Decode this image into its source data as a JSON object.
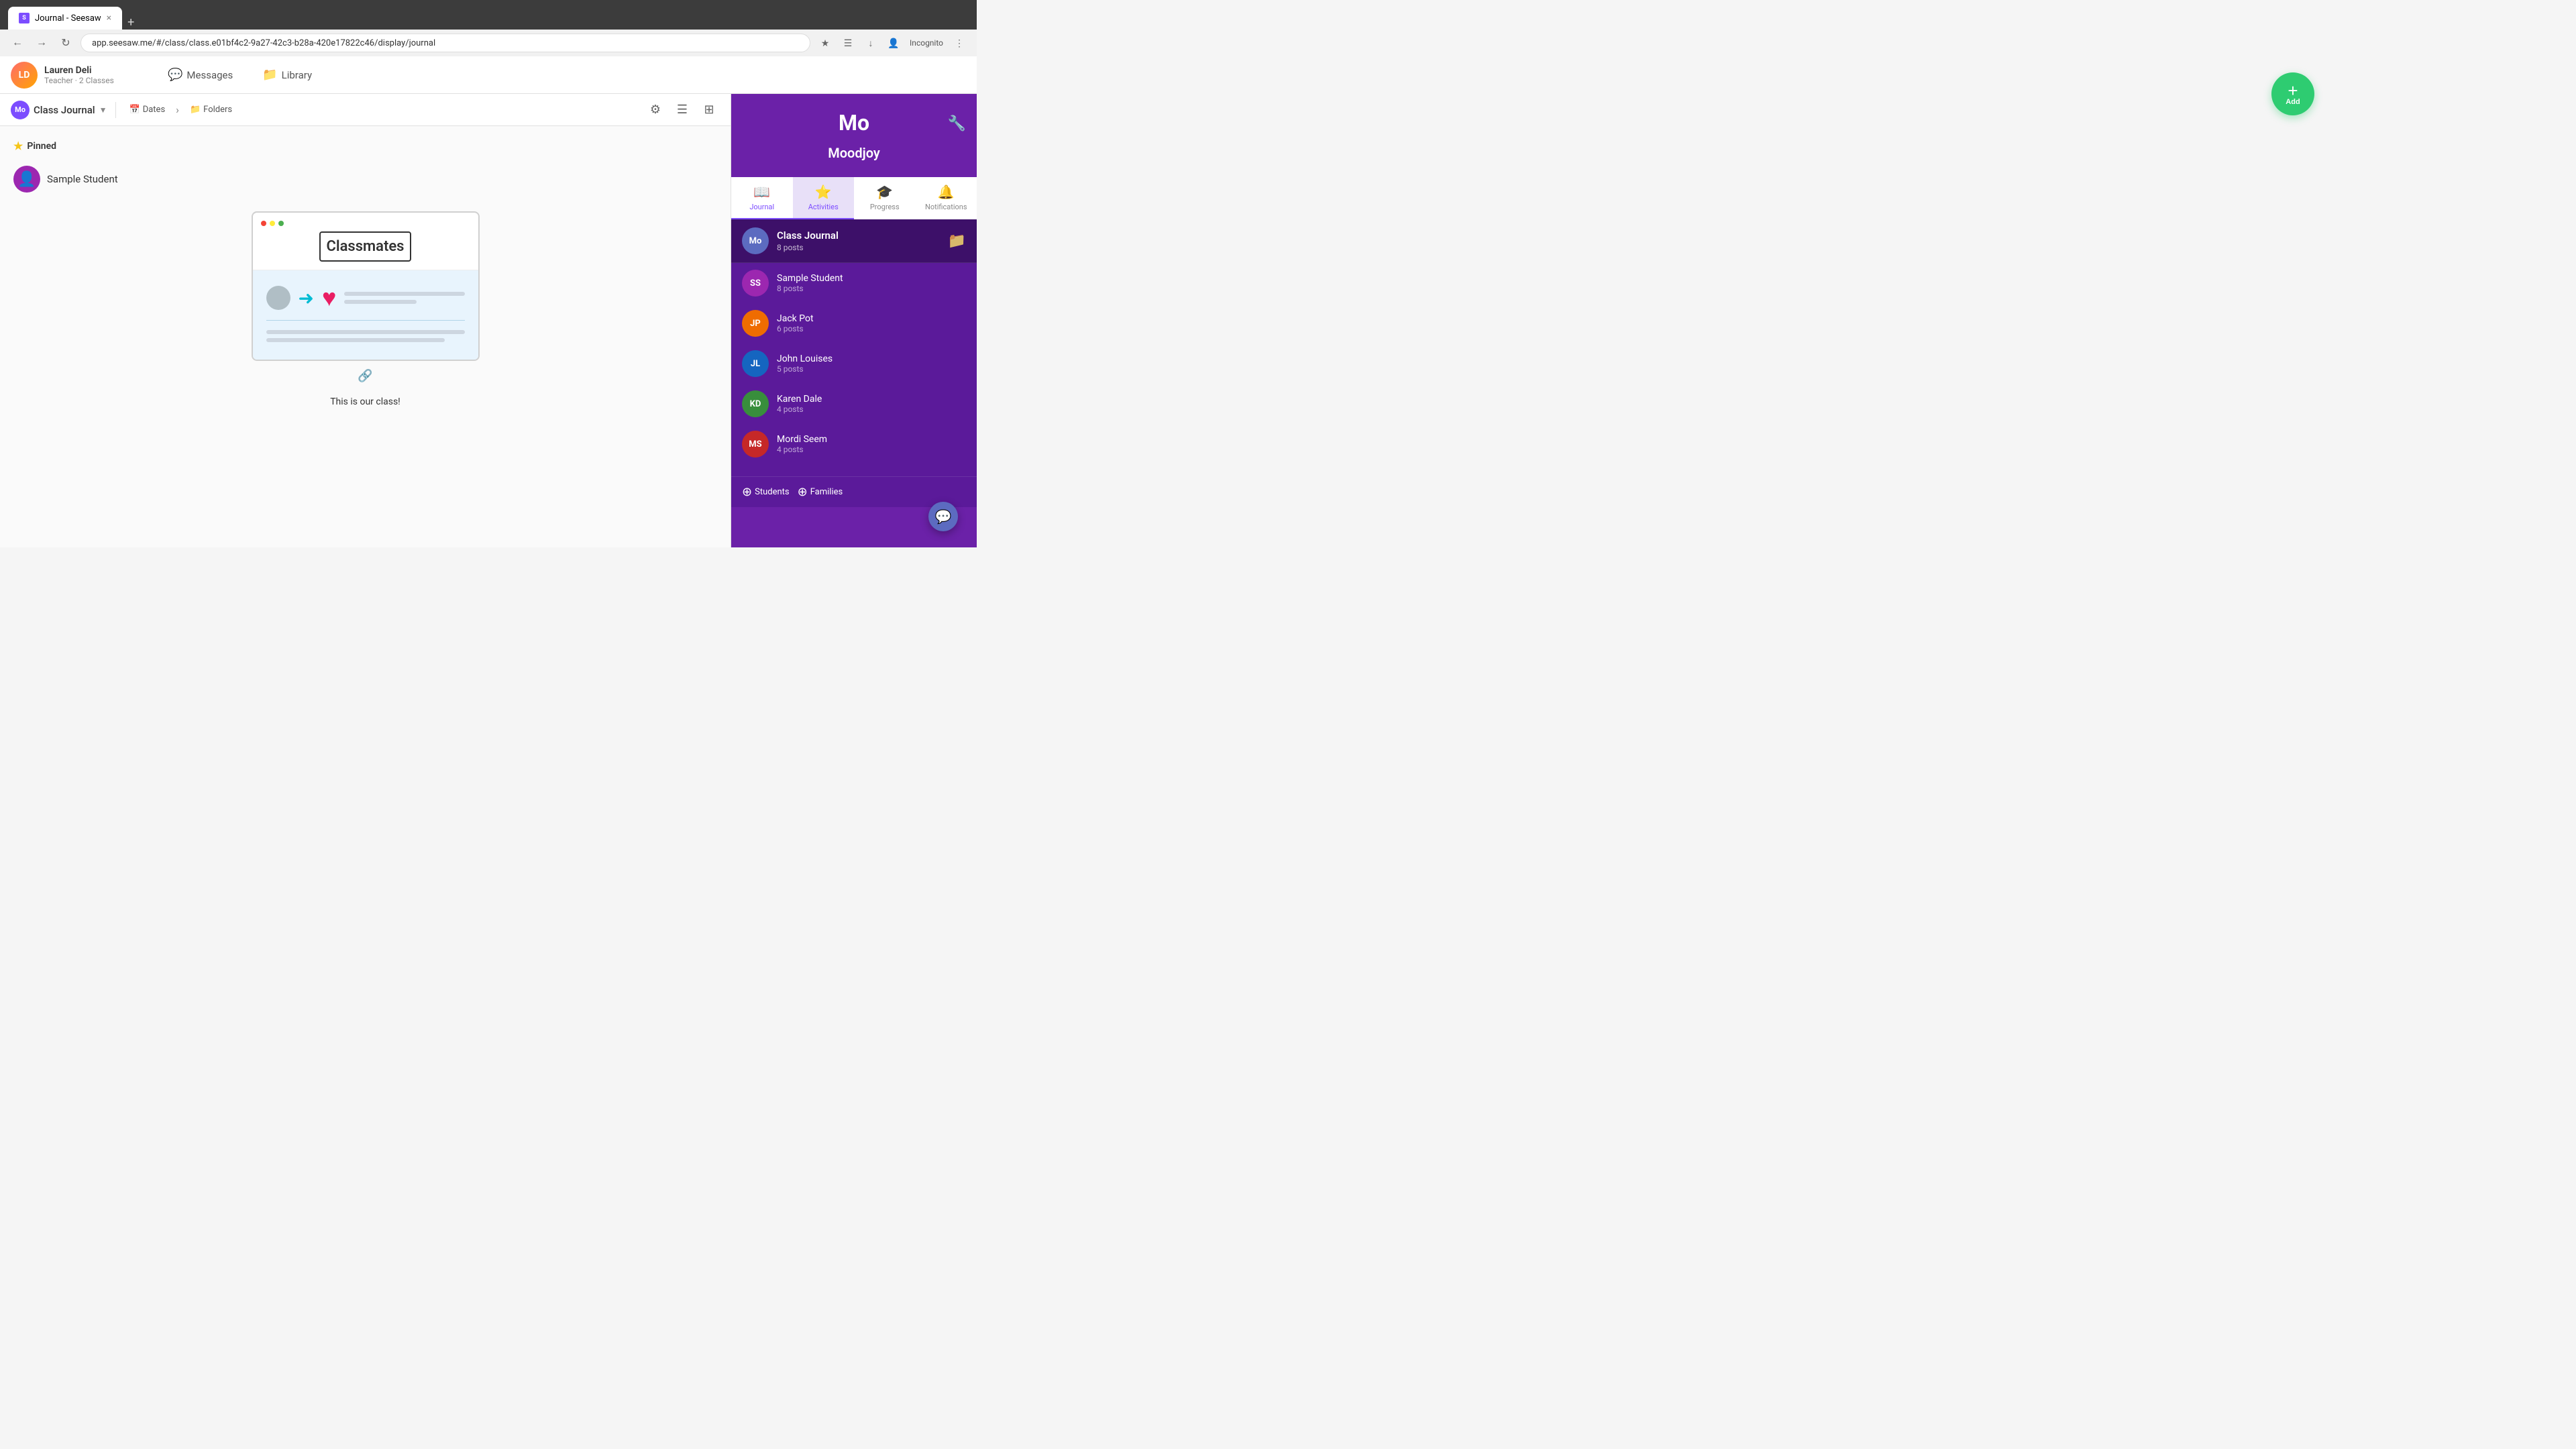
{
  "browser": {
    "tab_favicon": "S",
    "tab_title": "Journal - Seesaw",
    "tab_close": "×",
    "tab_new": "+",
    "url": "app.seesaw.me/#/class/class.e01bf4c2-9a27-42c3-b28a-420e17822c46/display/journal",
    "incognito_label": "Incognito"
  },
  "top_nav": {
    "user_name": "Lauren Deli",
    "user_role": "Teacher · 2 Classes",
    "messages_label": "Messages",
    "library_label": "Library",
    "add_label": "Add"
  },
  "class_toolbar": {
    "class_badge": "Mo",
    "class_name": "Class Journal",
    "dates_label": "Dates",
    "folders_label": "Folders"
  },
  "content": {
    "pinned_label": "Pinned",
    "sample_student_name": "Sample Student",
    "classmates_title": "Classmates",
    "post_description": "This is our class!",
    "link_icon": "🔗"
  },
  "sidebar": {
    "mo_label": "Mo",
    "subtitle": "Moodjoy",
    "nav_items": [
      {
        "id": "journal",
        "label": "Journal",
        "icon": "📖"
      },
      {
        "id": "activities",
        "label": "Activities",
        "icon": "⭐"
      },
      {
        "id": "progress",
        "label": "Progress",
        "icon": "🎓"
      },
      {
        "id": "notifications",
        "label": "Notifications",
        "icon": "🔔"
      }
    ],
    "class_journal": {
      "badge": "Mo",
      "name": "Class Journal",
      "posts": "8 posts"
    },
    "students": [
      {
        "initials": "SS",
        "name": "Sample Student",
        "posts": "8 posts",
        "color": "#9c27b0"
      },
      {
        "initials": "JP",
        "name": "Jack Pot",
        "posts": "6 posts",
        "color": "#ef6c00"
      },
      {
        "initials": "JL",
        "name": "John Louises",
        "posts": "5 posts",
        "color": "#1565c0"
      },
      {
        "initials": "KD",
        "name": "Karen Dale",
        "posts": "4 posts",
        "color": "#388e3c"
      },
      {
        "initials": "MS",
        "name": "Mordi Seem",
        "posts": "4 posts",
        "color": "#c62828"
      }
    ],
    "students_label": "Students",
    "families_label": "Families"
  }
}
